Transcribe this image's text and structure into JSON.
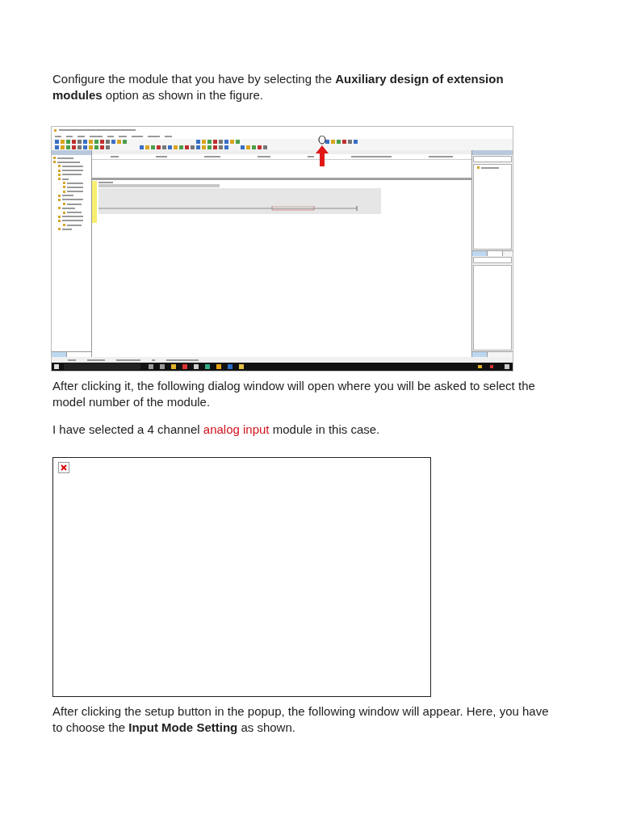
{
  "blocks": [
    {
      "kind": "text",
      "segments": [
        {
          "text": "Configure the module that you have by selecting the **Auxiliary design of extension modules** option as shown in the figure."
        }
      ]
    },
    {
      "kind": "app"
    },
    {
      "kind": "text",
      "segments": [
        {
          "text": "After clicking it, the following dialog window will open where you will be asked to select the model number of the module."
        }
      ]
    },
    {
      "kind": "text",
      "segments": [
        {
          "text": "I have selected a 4 channel "
        },
        {
          "text": "analog input",
          "link": true
        },
        {
          "text": " module in this case."
        }
      ]
    },
    {
      "kind": "broken_image"
    },
    {
      "kind": "text",
      "segments": [
        {
          "text": "After clicking the setup button in the popup, the following window will appear. Here, you have to choose the **Input Mode Setting** as shown."
        }
      ]
    }
  ]
}
